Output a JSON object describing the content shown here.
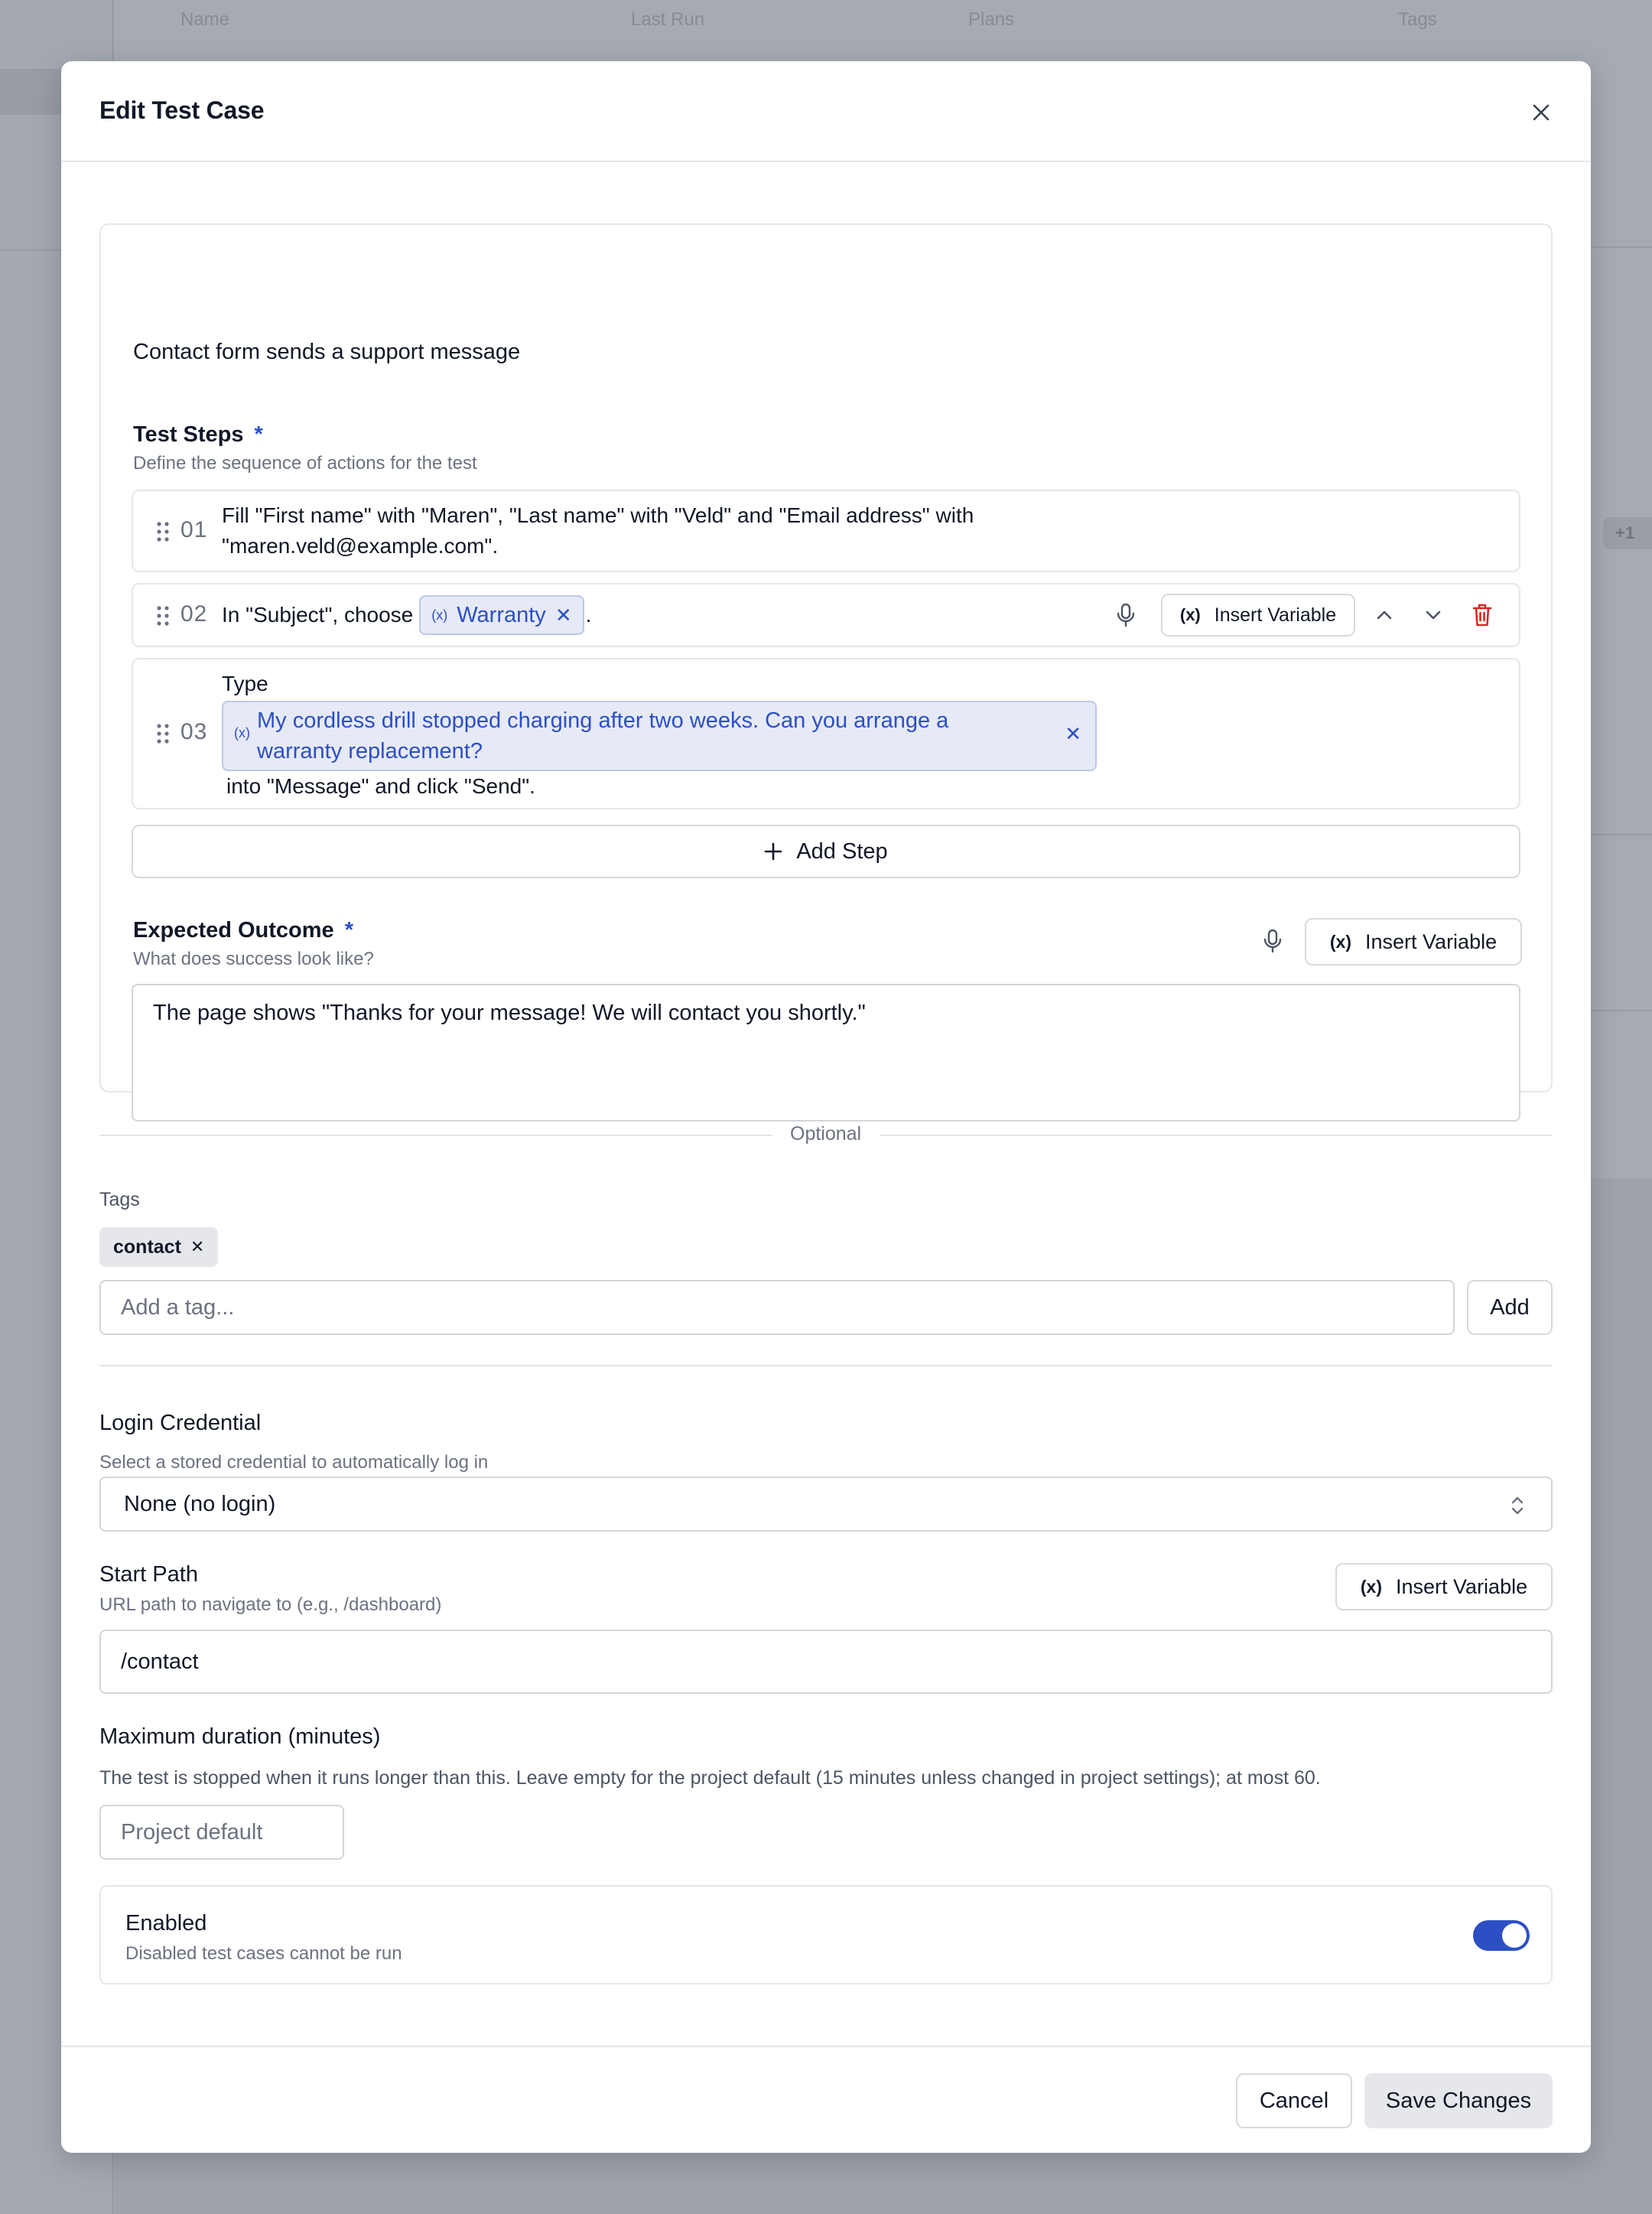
{
  "background": {
    "columns": [
      "Name",
      "Last Run",
      "Plans",
      "Tags"
    ],
    "badges": [
      "+1"
    ]
  },
  "dialog": {
    "title": "Edit Test Case",
    "close_label": "close"
  },
  "test_case": {
    "title": "Contact form sends a support message"
  },
  "test_steps": {
    "label": "Test Steps",
    "required_mark": "*",
    "hint": "Define the sequence of actions for the test",
    "steps": [
      {
        "number": "01",
        "text_line1": "Fill \"First name\" with \"Maren\", \"Last name\" with \"Veld\" and \"Email address\" with",
        "text_line2": "\"maren.veld@example.com\"."
      },
      {
        "number": "02",
        "prefix": "In \"Subject\", choose",
        "variable": "Warranty",
        "suffix": "."
      },
      {
        "number": "03",
        "prefix": "Type",
        "variable_line1": "My cordless drill stopped charging after two weeks. Can you arrange a",
        "variable_line2": "warranty replacement?",
        "suffix": "into \"Message\" and click \"Send\"."
      }
    ],
    "insert_variable_label": "Insert Variable",
    "add_step_label": "Add Step"
  },
  "expected_outcome": {
    "label": "Expected Outcome",
    "required_mark": "*",
    "hint": "What does success look like?",
    "insert_variable_label": "Insert Variable",
    "value": "The page shows \"Thanks for your message! We will contact you shortly.\""
  },
  "optional_divider": "Optional",
  "tags": {
    "label": "Tags",
    "items": [
      "contact"
    ],
    "input_placeholder": "Add a tag...",
    "add_label": "Add"
  },
  "login_credential": {
    "label": "Login Credential",
    "hint": "Select a stored credential to automatically log in",
    "selected": "None (no login)"
  },
  "start_path": {
    "label": "Start Path",
    "hint": "URL path to navigate to (e.g., /dashboard)",
    "insert_variable_label": "Insert Variable",
    "value": "/contact"
  },
  "max_duration": {
    "label": "Maximum duration (minutes)",
    "hint": "The test is stopped when it runs longer than this. Leave empty for the project default (15 minutes unless changed in project settings); at most 60.",
    "placeholder": "Project default"
  },
  "enabled": {
    "label": "Enabled",
    "hint": "Disabled test cases cannot be run",
    "value": true
  },
  "footer": {
    "cancel_label": "Cancel",
    "save_label": "Save Changes"
  },
  "colors": {
    "accent": "#2d4fc4",
    "danger": "#dc2626",
    "chip_bg": "#e6eaf6",
    "backdrop": "#a3a7b0"
  }
}
